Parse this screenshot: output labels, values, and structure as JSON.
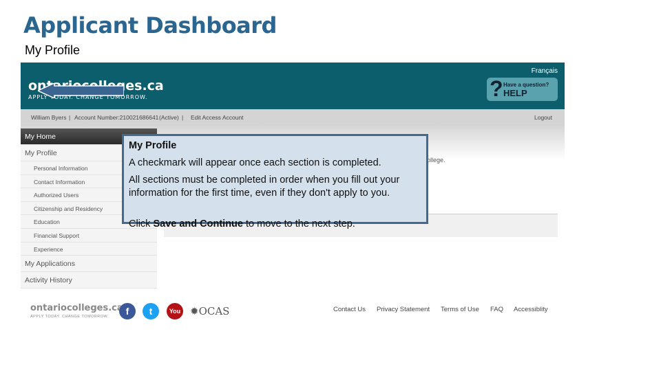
{
  "slide": {
    "title": "Applicant Dashboard",
    "subtitle": "My Profile"
  },
  "header": {
    "logo": "ontariocolleges.ca",
    "tagline": "APPLY TODAY. CHANGE TOMORROW.",
    "language": "Français",
    "help_small": "Have a question?",
    "help_big": "HELP",
    "help_icon": "question-mark-icon"
  },
  "account": {
    "name": "William Byers",
    "separator": "|",
    "account_number": "Account Number:210021686641",
    "status": "(Active)",
    "edit": "Edit Access Account",
    "logout": "Logout"
  },
  "sidebar": {
    "home": "My Home",
    "profile": "My Profile",
    "profile_items": [
      "Personal Information",
      "Contact Information",
      "Authorized Users",
      "Citizenship and Residency",
      "Education",
      "Financial Support",
      "Experience"
    ],
    "applications": "My Applications",
    "history": "Activity History"
  },
  "content": {
    "partial_text": "ollege."
  },
  "tooltip": {
    "heading": "My Profile",
    "line1": "A checkmark will appear once each section is completed.",
    "line2": "All sections must be completed in order when you fill out your  information for the first time, even if they don't apply to you.",
    "line3_pre": "Click ",
    "line3_bold": "Save and Continue",
    "line3_post": " to move to the next step."
  },
  "footer": {
    "logo": "ontariocolleges.ca",
    "tagline": "APPLY TODAY. CHANGE TOMORROW.",
    "social": [
      "facebook-icon",
      "twitter-icon",
      "youtube-icon"
    ],
    "ocas": "OCAS",
    "links": [
      "Contact Us",
      "Privacy Statement",
      "Terms of Use",
      "FAQ",
      "Accessiblity"
    ]
  },
  "colors": {
    "header": "#0d5e6c",
    "title": "#2a6690",
    "tooltip_bg": "#d4e1ec",
    "tooltip_border": "#44698e",
    "arrow": "#3a6590"
  }
}
